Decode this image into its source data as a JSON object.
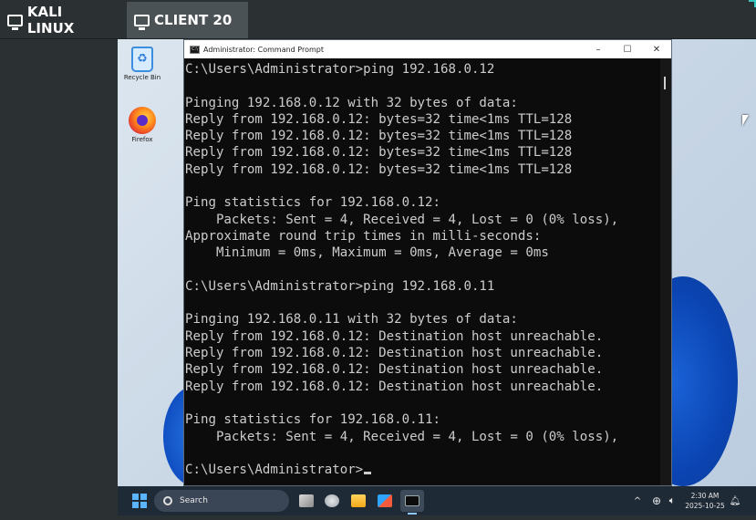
{
  "lab": {
    "tabs": [
      {
        "label": "KALI LINUX",
        "icon": "monitor-icon"
      },
      {
        "label": "CLIENT 20",
        "icon": "monitor-icon"
      }
    ],
    "active_tab": "CLIENT 20"
  },
  "desktop": {
    "icons": [
      {
        "label": "Recycle Bin",
        "icon": "recycle-bin-icon"
      },
      {
        "label": "Firefox",
        "icon": "firefox-icon"
      }
    ]
  },
  "cmd": {
    "title": "Administrator: Command Prompt",
    "controls": {
      "minimize": "–",
      "maximize": "☐",
      "close": "✕"
    },
    "lines": [
      "C:\\Users\\Administrator>ping 192.168.0.12",
      "",
      "Pinging 192.168.0.12 with 32 bytes of data:",
      "Reply from 192.168.0.12: bytes=32 time<1ms TTL=128",
      "Reply from 192.168.0.12: bytes=32 time<1ms TTL=128",
      "Reply from 192.168.0.12: bytes=32 time<1ms TTL=128",
      "Reply from 192.168.0.12: bytes=32 time<1ms TTL=128",
      "",
      "Ping statistics for 192.168.0.12:",
      "    Packets: Sent = 4, Received = 4, Lost = 0 (0% loss),",
      "Approximate round trip times in milli-seconds:",
      "    Minimum = 0ms, Maximum = 0ms, Average = 0ms",
      "",
      "C:\\Users\\Administrator>ping 192.168.0.11",
      "",
      "Pinging 192.168.0.11 with 32 bytes of data:",
      "Reply from 192.168.0.12: Destination host unreachable.",
      "Reply from 192.168.0.12: Destination host unreachable.",
      "Reply from 192.168.0.12: Destination host unreachable.",
      "Reply from 192.168.0.12: Destination host unreachable.",
      "",
      "Ping statistics for 192.168.0.11:",
      "    Packets: Sent = 4, Received = 4, Lost = 0 (0% loss),",
      "",
      "C:\\Users\\Administrator>"
    ]
  },
  "taskbar": {
    "search_placeholder": "Search",
    "pinned": [
      "task-view-icon",
      "widgets-icon",
      "file-explorer-icon",
      "store-icon",
      "terminal-icon"
    ],
    "tray": {
      "chevron": "^",
      "time": "2:30 AM",
      "date": "2025-10-25"
    }
  },
  "colors": {
    "terminal_bg": "#0c0c0c",
    "terminal_fg": "#cccccc",
    "lab_bar": "#2b3033",
    "active_tab": "#4a5256",
    "taskbar": "#1f2a37"
  }
}
